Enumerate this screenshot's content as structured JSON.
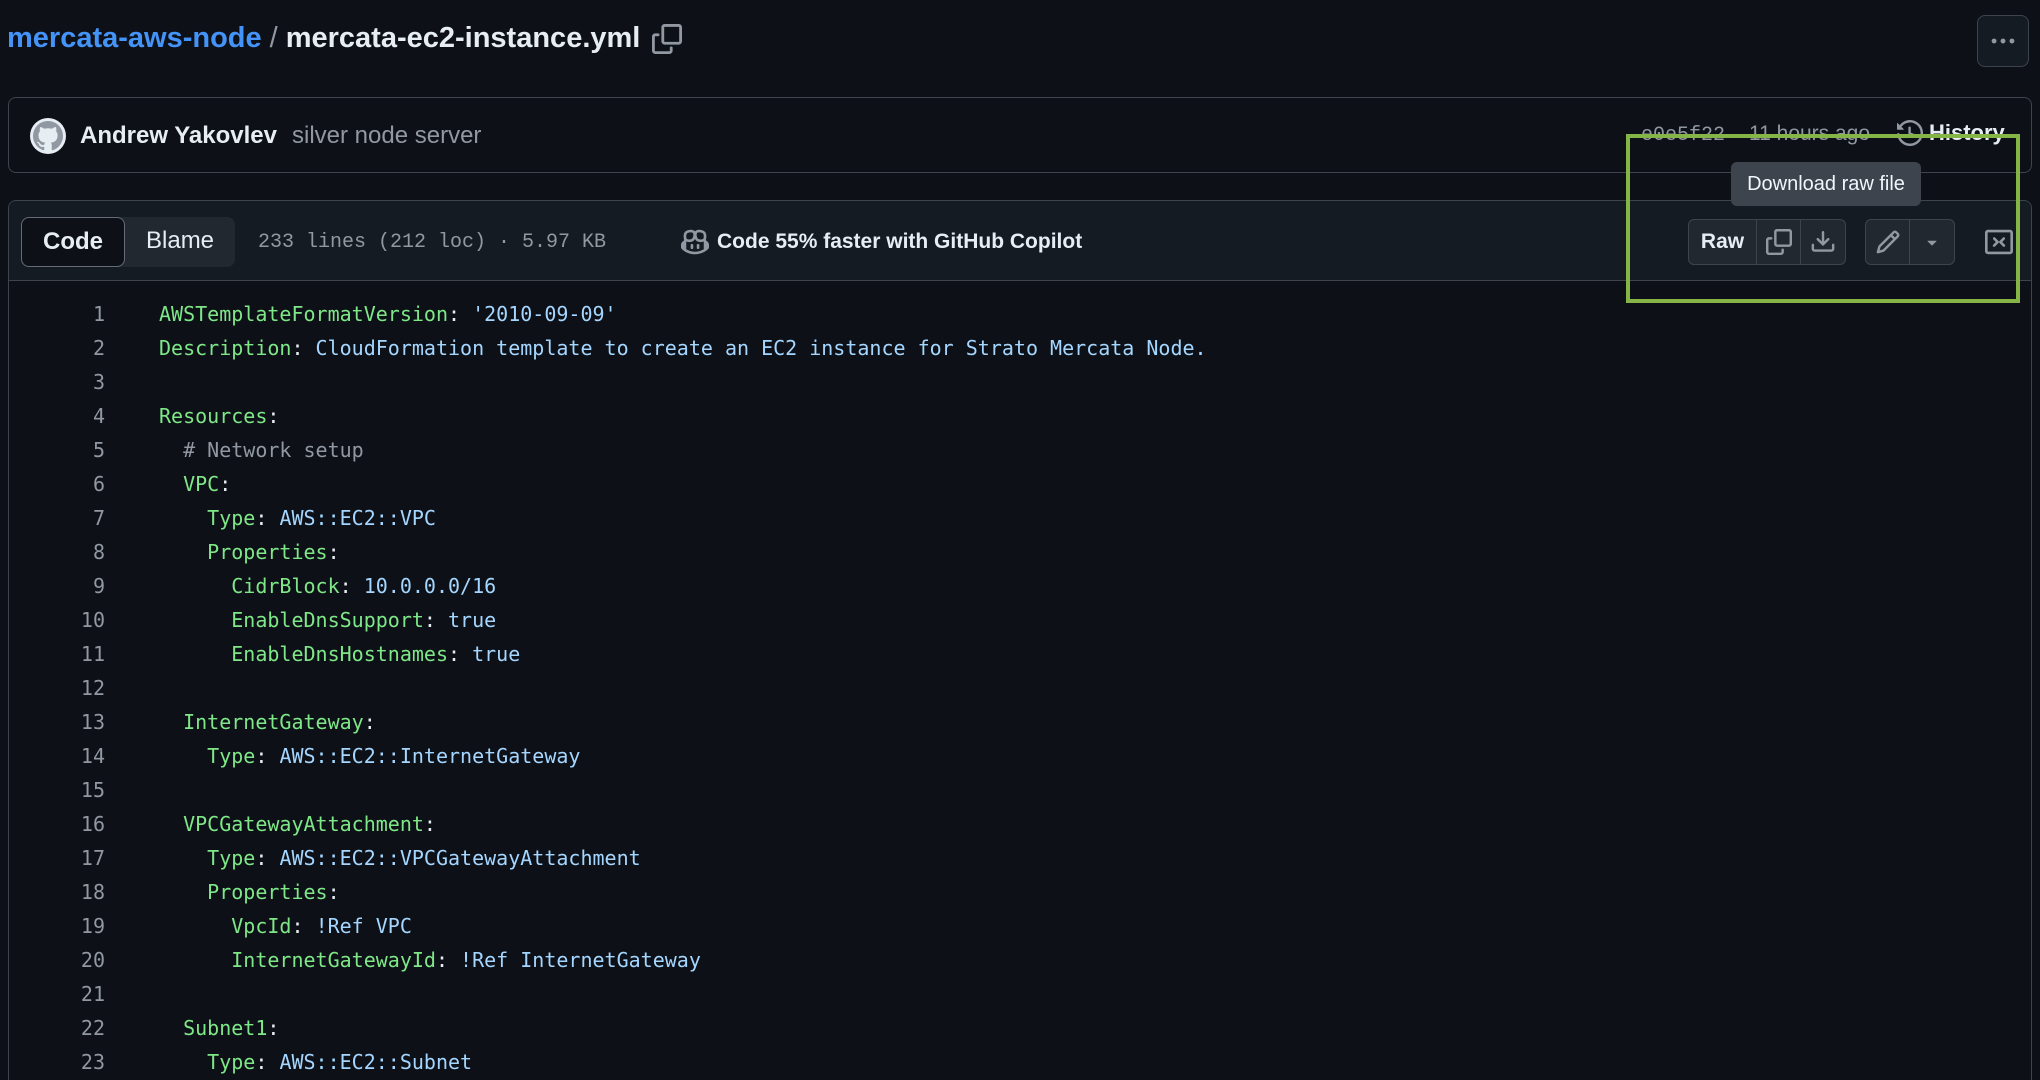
{
  "breadcrumb": {
    "repo": "mercata-aws-node",
    "separator": "/",
    "file": "mercata-ec2-instance.yml"
  },
  "commit": {
    "author": "Andrew Yakovlev",
    "message": "silver node server",
    "sha": "e0e5f22",
    "time": "11 hours ago",
    "history_label": "History"
  },
  "file_header": {
    "tabs": [
      {
        "label": "Code",
        "active": true
      },
      {
        "label": "Blame",
        "active": false
      }
    ],
    "meta": "233 lines (212 loc) · 5.97 KB",
    "copilot": "Code 55% faster with GitHub Copilot",
    "raw_label": "Raw",
    "tooltip": "Download raw file"
  },
  "colors": {
    "link": "#4493f8",
    "key": "#7ee787",
    "value": "#a5d6ff",
    "highlight_box": "#84b546"
  },
  "icons": [
    "copy-path-icon",
    "kebab-menu-icon",
    "github-avatar-icon",
    "history-icon",
    "copilot-icon",
    "copy-icon",
    "download-icon",
    "pencil-icon",
    "caret-down-icon",
    "symbols-icon"
  ],
  "code_lines": [
    {
      "n": "1",
      "indent": "",
      "key": "AWSTemplateFormatVersion",
      "sep": ": ",
      "val": "'2010-09-09'",
      "comment": ""
    },
    {
      "n": "2",
      "indent": "",
      "key": "Description",
      "sep": ": ",
      "val": "CloudFormation template to create an EC2 instance for Strato Mercata Node.",
      "comment": ""
    },
    {
      "n": "3",
      "indent": "",
      "key": "",
      "sep": "",
      "val": "",
      "comment": ""
    },
    {
      "n": "4",
      "indent": "",
      "key": "Resources",
      "sep": ":",
      "val": "",
      "comment": ""
    },
    {
      "n": "5",
      "indent": "  ",
      "key": "",
      "sep": "",
      "val": "",
      "comment": "# Network setup"
    },
    {
      "n": "6",
      "indent": "  ",
      "key": "VPC",
      "sep": ":",
      "val": "",
      "comment": ""
    },
    {
      "n": "7",
      "indent": "    ",
      "key": "Type",
      "sep": ": ",
      "val": "AWS::EC2::VPC",
      "comment": ""
    },
    {
      "n": "8",
      "indent": "    ",
      "key": "Properties",
      "sep": ":",
      "val": "",
      "comment": ""
    },
    {
      "n": "9",
      "indent": "      ",
      "key": "CidrBlock",
      "sep": ": ",
      "val": "10.0.0.0/16",
      "comment": ""
    },
    {
      "n": "10",
      "indent": "      ",
      "key": "EnableDnsSupport",
      "sep": ": ",
      "val": "true",
      "comment": ""
    },
    {
      "n": "11",
      "indent": "      ",
      "key": "EnableDnsHostnames",
      "sep": ": ",
      "val": "true",
      "comment": ""
    },
    {
      "n": "12",
      "indent": "",
      "key": "",
      "sep": "",
      "val": "",
      "comment": ""
    },
    {
      "n": "13",
      "indent": "  ",
      "key": "InternetGateway",
      "sep": ":",
      "val": "",
      "comment": ""
    },
    {
      "n": "14",
      "indent": "    ",
      "key": "Type",
      "sep": ": ",
      "val": "AWS::EC2::InternetGateway",
      "comment": ""
    },
    {
      "n": "15",
      "indent": "",
      "key": "",
      "sep": "",
      "val": "",
      "comment": ""
    },
    {
      "n": "16",
      "indent": "  ",
      "key": "VPCGatewayAttachment",
      "sep": ":",
      "val": "",
      "comment": ""
    },
    {
      "n": "17",
      "indent": "    ",
      "key": "Type",
      "sep": ": ",
      "val": "AWS::EC2::VPCGatewayAttachment",
      "comment": ""
    },
    {
      "n": "18",
      "indent": "    ",
      "key": "Properties",
      "sep": ":",
      "val": "",
      "comment": ""
    },
    {
      "n": "19",
      "indent": "      ",
      "key": "VpcId",
      "sep": ": ",
      "val": "!Ref VPC",
      "comment": ""
    },
    {
      "n": "20",
      "indent": "      ",
      "key": "InternetGatewayId",
      "sep": ": ",
      "val": "!Ref InternetGateway",
      "comment": ""
    },
    {
      "n": "21",
      "indent": "",
      "key": "",
      "sep": "",
      "val": "",
      "comment": ""
    },
    {
      "n": "22",
      "indent": "  ",
      "key": "Subnet1",
      "sep": ":",
      "val": "",
      "comment": ""
    },
    {
      "n": "23",
      "indent": "    ",
      "key": "Type",
      "sep": ": ",
      "val": "AWS::EC2::Subnet",
      "comment": ""
    }
  ]
}
